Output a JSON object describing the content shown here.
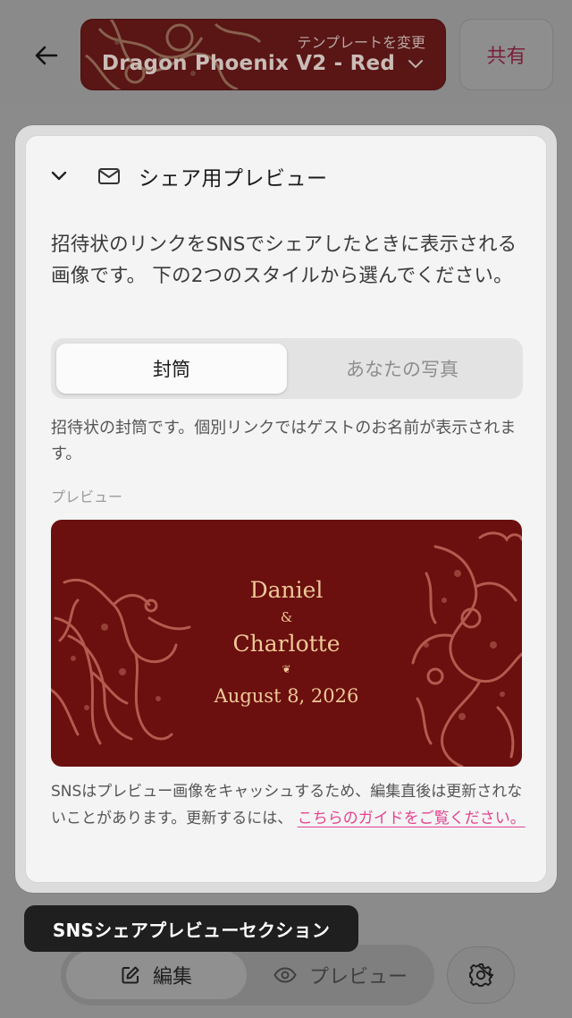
{
  "header": {
    "back_icon": "arrow-left-icon",
    "template_caption": "テンプレートを変更",
    "template_name": "Dragon Phoenix V2 - Red",
    "share_label": "共有"
  },
  "section": {
    "title": "シェア用プレビュー",
    "description": "招待状のリンクをSNSでシェアしたときに表示される画像です。 下の2つのスタイルから選んでください。",
    "tabs": [
      {
        "label": "封筒",
        "selected": true
      },
      {
        "label": "あなたの写真",
        "selected": false
      }
    ],
    "info": "招待状の封筒です。個別リンクではゲストのお名前が表示されます。",
    "preview_label": "プレビュー",
    "envelope": {
      "name1": "Daniel",
      "amp": "&",
      "name2": "Charlotte",
      "ornament": "❦",
      "date": "August 8, 2026"
    },
    "note_text": "SNSはプレビュー画像をキャッシュするため、編集直後は更新されないことがあります。更新するには、",
    "note_link": "こちらのガイドをご覧ください。"
  },
  "tooltip": "SNSシェアプレビューセクション",
  "bottom": {
    "edit_label": "編集",
    "preview_label": "プレビュー",
    "settings_icon": "gear-icon"
  },
  "colors": {
    "envelope_bg": "#6b0f0f",
    "envelope_text": "#efc997",
    "link": "#e2438f",
    "overlay": "#8b8b8b"
  }
}
